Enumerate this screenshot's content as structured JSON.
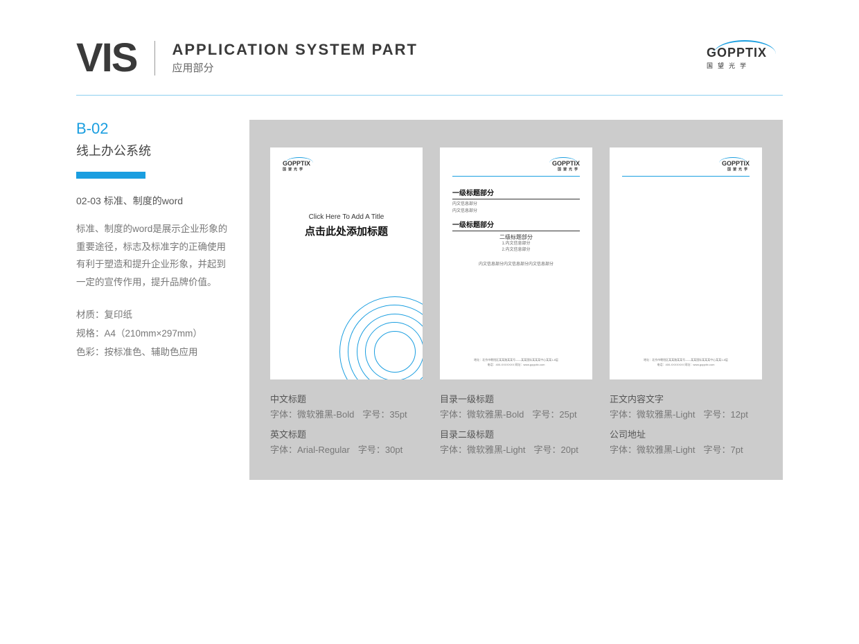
{
  "header": {
    "vis": "VIS",
    "titleEn": "APPLICATION SYSTEM PART",
    "titleCn": "应用部分",
    "logoText": "GOPPTIX",
    "logoSub": "国望光学"
  },
  "sidebar": {
    "code": "B-02",
    "title": "线上办公系统",
    "subtitle": "02-03  标准、制度的word",
    "paragraph": "标准、制度的word是展示企业形象的重要途径，标志及标准字的正确使用有利于塑造和提升企业形象，并起到一定的宣传作用，提升品牌价值。",
    "spec1": "材质：复印纸",
    "spec2": "规格：A4（210mm×297mm）",
    "spec3": "色彩：按标准色、辅助色应用"
  },
  "page1": {
    "logoText": "GOPPTIX",
    "logoSub": "国望光学",
    "titleEn": "Click Here To Add A Title",
    "titleCn": "点击此处添加标题"
  },
  "page2": {
    "logoText": "GOPPTIX",
    "logoSub": "国望光学",
    "h1a": "一级标题部分",
    "body1": "内文信息部分",
    "body2": "内文信息部分",
    "h1b": "一级标题部分",
    "h2": "二级标题部分",
    "sub1": "1.内文信息部分",
    "sub2": "2.内文信息部分",
    "line": "内文信息部分内文信息部分内文信息部分",
    "footer1": "地址：北京市朝阳区某某路某某号——某某国际某某某中心某某1-8层",
    "footer2": "电话：400-XXXXXXX      网址：www.gopptix.com"
  },
  "page3": {
    "logoText": "GOPPTIX",
    "logoSub": "国望光学",
    "footer1": "地址：北京市朝阳区某某路某某号——某某国际某某某中心某某1-8层",
    "footer2": "电话：400-XXXXXXX      网址：www.gopptix.com"
  },
  "captions": {
    "c1": {
      "title": "中文标题",
      "font": "字体：微软雅黑-Bold",
      "size": "字号：35pt"
    },
    "c1b": {
      "title": "英文标题",
      "font": "字体：Arial-Regular",
      "size": "字号：30pt"
    },
    "c2": {
      "title": "目录一级标题",
      "font": "字体：微软雅黑-Bold",
      "size": "字号：25pt"
    },
    "c2b": {
      "title": "目录二级标题",
      "font": "字体：微软雅黑-Light",
      "size": "字号：20pt"
    },
    "c3": {
      "title": "正文内容文字",
      "font": "字体：微软雅黑-Light",
      "size": "字号：12pt"
    },
    "c3b": {
      "title": "公司地址",
      "font": "字体：微软雅黑-Light",
      "size": "字号：7pt"
    }
  }
}
